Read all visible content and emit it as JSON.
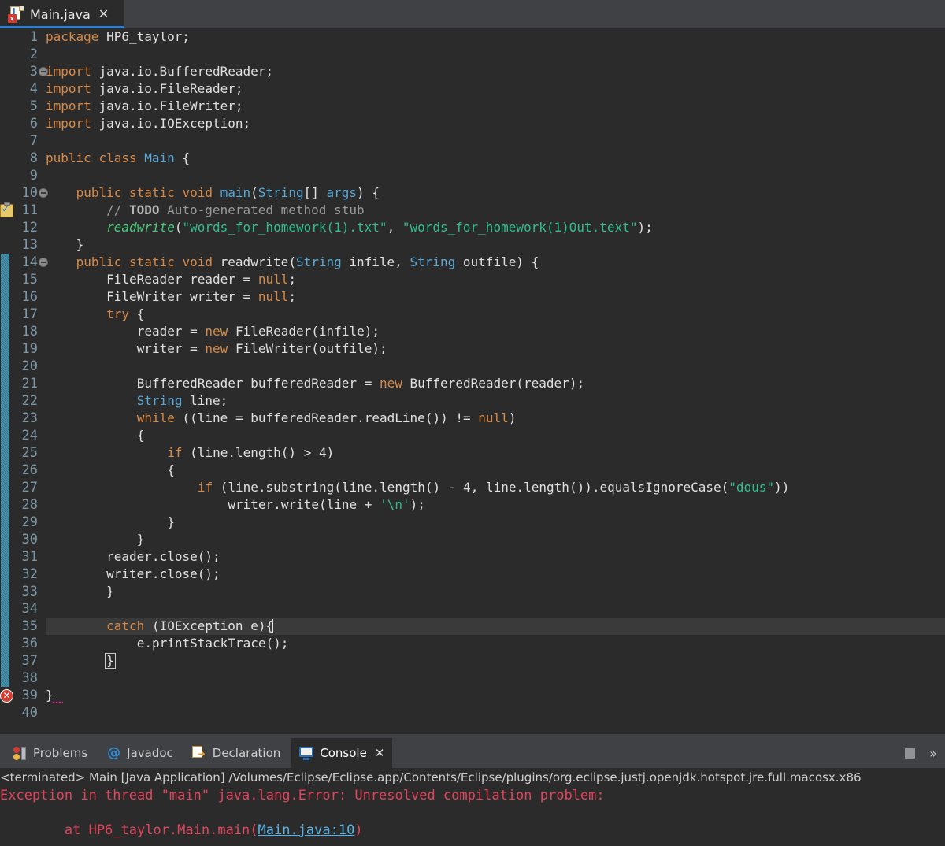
{
  "app": {
    "name": "Eclipse IDE",
    "theme": "dark",
    "accent_color": "#2f7fd0",
    "editor_bg": "#2b2b2b",
    "chrome_bg": "#3f4144",
    "error_color": "#d33c33",
    "console_error_color": "#e2445c",
    "link_color": "#5ab4e6"
  },
  "editor_tabbar": {
    "tabs": [
      {
        "label": "Main.java",
        "icon": "java-file-icon",
        "error_badge": "x",
        "close_label": "✕",
        "active": true
      }
    ]
  },
  "code": {
    "language": "java",
    "first_visible_line": 1,
    "last_visible_line": 40,
    "current_line": 35,
    "caret_line": 35,
    "caret_column_text": "catch (IOException e){",
    "gutter": {
      "fold_markers": [
        3,
        10,
        14
      ],
      "todo_marker_line": 11,
      "error_marker_line": 39,
      "error_marker_glyph": "✕",
      "change_bar_start_line": 14,
      "change_bar_end_line": 38,
      "change_bar_color": "#2f7b96"
    },
    "lines": [
      {
        "n": 1,
        "text": "package HP6_taylor;"
      },
      {
        "n": 2,
        "text": ""
      },
      {
        "n": 3,
        "text": "import java.io.BufferedReader;"
      },
      {
        "n": 4,
        "text": "import java.io.FileReader;"
      },
      {
        "n": 5,
        "text": "import java.io.FileWriter;"
      },
      {
        "n": 6,
        "text": "import java.io.IOException;"
      },
      {
        "n": 7,
        "text": ""
      },
      {
        "n": 8,
        "text": "public class Main {"
      },
      {
        "n": 9,
        "text": ""
      },
      {
        "n": 10,
        "text": "    public static void main(String[] args) {"
      },
      {
        "n": 11,
        "text": "        // TODO Auto-generated method stub"
      },
      {
        "n": 12,
        "text": "        readwrite(\"words_for_homework(1).txt\", \"words_for_homework(1)Out.text\");"
      },
      {
        "n": 13,
        "text": "    }"
      },
      {
        "n": 14,
        "text": "    public static void readwrite(String infile, String outfile) {"
      },
      {
        "n": 15,
        "text": "        FileReader reader = null;"
      },
      {
        "n": 16,
        "text": "        FileWriter writer = null;"
      },
      {
        "n": 17,
        "text": "        try {"
      },
      {
        "n": 18,
        "text": "            reader = new FileReader(infile);"
      },
      {
        "n": 19,
        "text": "            writer = new FileWriter(outfile);"
      },
      {
        "n": 20,
        "text": ""
      },
      {
        "n": 21,
        "text": "            BufferedReader bufferedReader = new BufferedReader(reader);"
      },
      {
        "n": 22,
        "text": "            String line;"
      },
      {
        "n": 23,
        "text": "            while ((line = bufferedReader.readLine()) != null)"
      },
      {
        "n": 24,
        "text": "            {"
      },
      {
        "n": 25,
        "text": "                if (line.length() > 4)"
      },
      {
        "n": 26,
        "text": "                {"
      },
      {
        "n": 27,
        "text": "                    if (line.substring(line.length() - 4, line.length()).equalsIgnoreCase(\"dous\"))"
      },
      {
        "n": 28,
        "text": "                        writer.write(line + '\\n');"
      },
      {
        "n": 29,
        "text": "                }"
      },
      {
        "n": 30,
        "text": "            }"
      },
      {
        "n": 31,
        "text": "        reader.close();"
      },
      {
        "n": 32,
        "text": "        writer.close();"
      },
      {
        "n": 33,
        "text": "        }"
      },
      {
        "n": 34,
        "text": ""
      },
      {
        "n": 35,
        "text": "        catch (IOException e){"
      },
      {
        "n": 36,
        "text": "            e.printStackTrace();"
      },
      {
        "n": 37,
        "text": "        }"
      },
      {
        "n": 38,
        "text": ""
      },
      {
        "n": 39,
        "text": "}"
      },
      {
        "n": 40,
        "text": ""
      }
    ]
  },
  "bottom_panel": {
    "tabs": [
      {
        "label": "Problems",
        "icon": "problems-icon",
        "active": false,
        "closable": false
      },
      {
        "label": "Javadoc",
        "icon": "javadoc-icon",
        "active": false,
        "closable": false
      },
      {
        "label": "Declaration",
        "icon": "declaration-icon",
        "active": false,
        "closable": false
      },
      {
        "label": "Console",
        "icon": "console-icon",
        "active": true,
        "closable": true,
        "close_label": "✕"
      }
    ],
    "toolbar": {
      "terminate_label": "terminate-button",
      "more_label": "»"
    }
  },
  "console": {
    "header": "<terminated> Main [Java Application] /Volumes/Eclipse/Eclipse.app/Contents/Eclipse/plugins/org.eclipse.justj.openjdk.hotspot.jre.full.macosx.x86",
    "lines": [
      {
        "text": "Exception in thread \"main\" java.lang.Error: Unresolved compilation problem: ",
        "link": null
      },
      {
        "text": "",
        "link": null
      },
      {
        "text": "\tat HP6_taylor.Main.main(",
        "link": "Main.java:10",
        "tail": ")"
      }
    ]
  }
}
